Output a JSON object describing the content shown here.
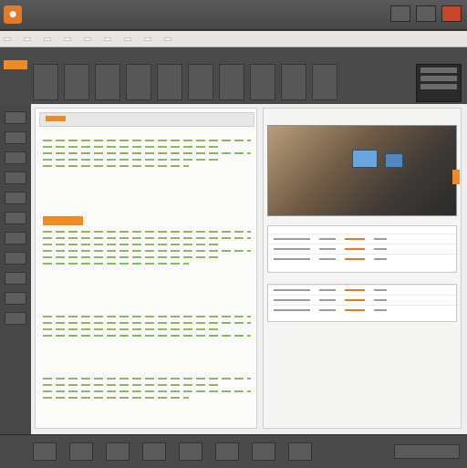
{
  "colors": {
    "accent": "#f08a24",
    "chrome": "#4a4a4a",
    "doc_bg": "#fbfbfa",
    "text_line": "#8db86a",
    "photo_screen": "#67a6e0"
  },
  "icons": {
    "app": "app-icon",
    "left_tools": [
      "tool-icon",
      "tool-icon",
      "tool-icon",
      "tool-icon",
      "tool-icon",
      "tool-icon",
      "tool-icon",
      "tool-icon",
      "tool-icon",
      "tool-icon",
      "tool-icon"
    ]
  }
}
